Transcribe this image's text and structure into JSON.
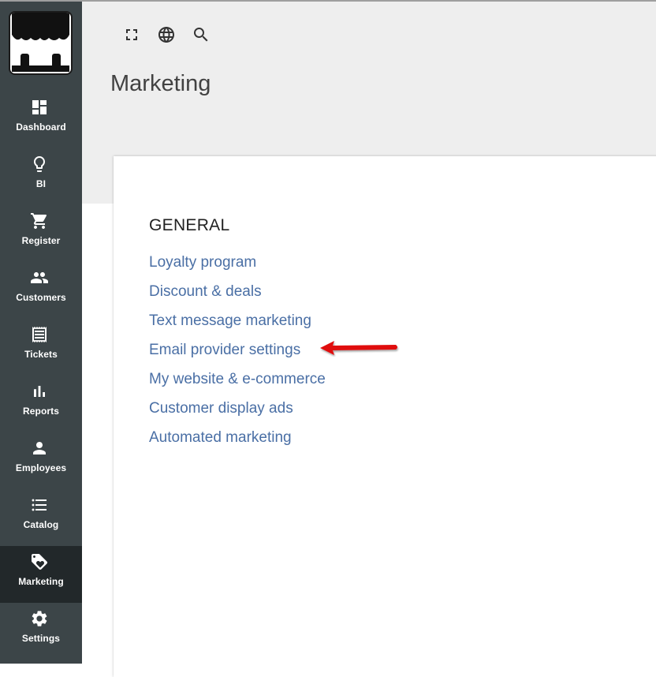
{
  "app": {
    "brand_colors": {
      "sidebar": "#3c4548",
      "sidebar_active": "#22282a",
      "link": "#4a6fa5",
      "header_bg": "#eeeeee",
      "annotation_arrow": "#e01010"
    }
  },
  "sidebar": {
    "logo_icon": "storefront-awning-icon",
    "items": [
      {
        "label": "Dashboard",
        "icon": "dashboard-icon",
        "active": false
      },
      {
        "label": "BI",
        "icon": "lightbulb-icon",
        "active": false
      },
      {
        "label": "Register",
        "icon": "cart-icon",
        "active": false
      },
      {
        "label": "Customers",
        "icon": "people-icon",
        "active": false
      },
      {
        "label": "Tickets",
        "icon": "receipt-icon",
        "active": false
      },
      {
        "label": "Reports",
        "icon": "bar-chart-icon",
        "active": false
      },
      {
        "label": "Employees",
        "icon": "person-icon",
        "active": false
      },
      {
        "label": "Catalog",
        "icon": "list-icon",
        "active": false
      },
      {
        "label": "Marketing",
        "icon": "tag-icon",
        "active": true
      },
      {
        "label": "Settings",
        "icon": "gear-icon",
        "active": false
      }
    ]
  },
  "toolbar": {
    "icons": [
      "fullscreen-icon",
      "globe-icon",
      "search-icon"
    ]
  },
  "page": {
    "title": "Marketing"
  },
  "general": {
    "title": "GENERAL",
    "links": [
      "Loyalty program",
      "Discount & deals",
      "Text message marketing",
      "Email provider settings",
      "My website & e-commerce",
      "Customer display ads",
      "Automated marketing"
    ]
  },
  "annotation": {
    "icon": "red-arrow-icon",
    "points_to": "Email provider settings"
  }
}
